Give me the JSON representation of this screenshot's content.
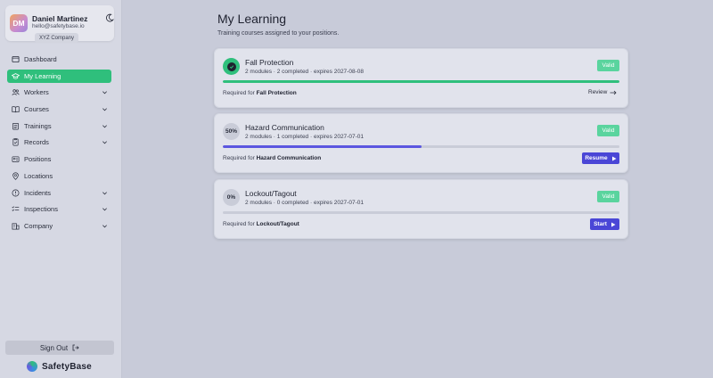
{
  "user": {
    "initials": "DM",
    "name": "Daniel Martinez",
    "email": "hello@safetybase.io",
    "company": "XYZ Company"
  },
  "sidebar": {
    "items": [
      {
        "label": "Dashboard",
        "icon": "dashboard-icon",
        "active": false,
        "has_chevron": false
      },
      {
        "label": "My Learning",
        "icon": "graduation-cap-icon",
        "active": true,
        "has_chevron": false
      },
      {
        "label": "Workers",
        "icon": "users-icon",
        "active": false,
        "has_chevron": true
      },
      {
        "label": "Courses",
        "icon": "book-icon",
        "active": false,
        "has_chevron": true
      },
      {
        "label": "Trainings",
        "icon": "clipboard-icon",
        "active": false,
        "has_chevron": true
      },
      {
        "label": "Records",
        "icon": "records-icon",
        "active": false,
        "has_chevron": true
      },
      {
        "label": "Positions",
        "icon": "id-card-icon",
        "active": false,
        "has_chevron": false
      },
      {
        "label": "Locations",
        "icon": "map-pin-icon",
        "active": false,
        "has_chevron": false
      },
      {
        "label": "Incidents",
        "icon": "alert-icon",
        "active": false,
        "has_chevron": true
      },
      {
        "label": "Inspections",
        "icon": "list-check-icon",
        "active": false,
        "has_chevron": true
      },
      {
        "label": "Company",
        "icon": "building-icon",
        "active": false,
        "has_chevron": true
      }
    ],
    "sign_out_label": "Sign Out",
    "brand_name": "SafetyBase"
  },
  "main": {
    "title": "My Learning",
    "subtitle": "Training courses assigned to your positions.",
    "courses": [
      {
        "title": "Fall Protection",
        "meta": "2 modules · 2 completed · expires 2027-08-08",
        "status": "Valid",
        "progress_pct": 100,
        "progress_label": "",
        "required_prefix": "Required for ",
        "required_for": "Fall Protection",
        "action_label": "Review",
        "action_style": "link",
        "progress_color": "#2fbf7c"
      },
      {
        "title": "Hazard Communication",
        "meta": "2 modules · 1 completed · expires 2027-07-01",
        "status": "Valid",
        "progress_pct": 50,
        "progress_label": "50%",
        "required_prefix": "Required for ",
        "required_for": "Hazard Communication",
        "action_label": "Resume",
        "action_style": "button",
        "progress_color": "#5b57e0"
      },
      {
        "title": "Lockout/Tagout",
        "meta": "2 modules · 0 completed · expires 2027-07-01",
        "status": "Valid",
        "progress_pct": 0,
        "progress_label": "0%",
        "required_prefix": "Required for ",
        "required_for": "Lockout/Tagout",
        "action_label": "Start",
        "action_style": "button",
        "progress_color": "#5b57e0"
      }
    ]
  },
  "colors": {
    "accent_green": "#2fbf7c",
    "accent_purple": "#4a46d6",
    "valid_badge": "#5ad49e"
  }
}
